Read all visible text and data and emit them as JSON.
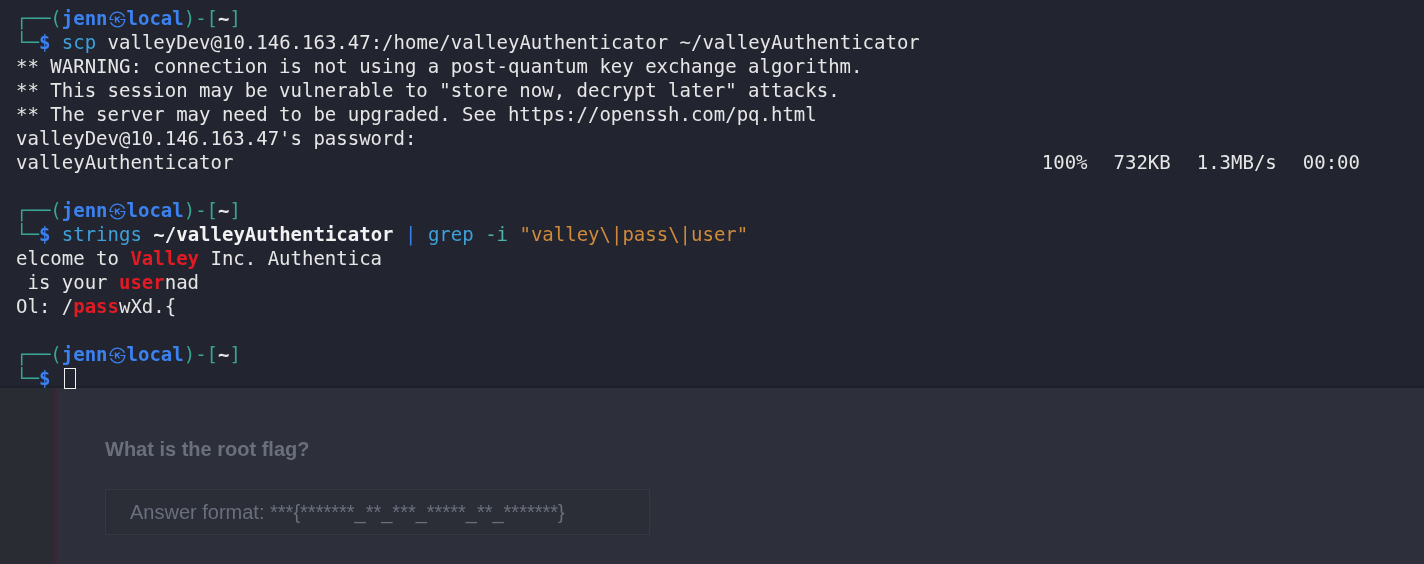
{
  "terminal": {
    "blocks": [
      {
        "kind": "prompt",
        "open": "┌──(",
        "user": "jenn",
        "at": "㉿",
        "host": "local",
        "mid": ")-[",
        "dir": "~",
        "close": "]",
        "corner": "└─",
        "sigil": "$",
        "tokens": [
          {
            "kind": "command",
            "text": "scp"
          },
          {
            "kind": "arg",
            "text": "valleyDev@10.146.163.47:/home/valleyAuthenticator"
          },
          {
            "kind": "arg",
            "text": "~/valleyAuthenticator"
          }
        ]
      },
      {
        "kind": "output",
        "segments": [
          {
            "text": "** WARNING: connection is not using a post-quantum key exchange algorithm.",
            "match": false
          }
        ]
      },
      {
        "kind": "output",
        "segments": [
          {
            "text": "** This session may be vulnerable to \"store now, decrypt later\" attacks.",
            "match": false
          }
        ]
      },
      {
        "kind": "output",
        "segments": [
          {
            "text": "** The server may need to be upgraded. See https://openssh.com/pq.html",
            "match": false
          }
        ]
      },
      {
        "kind": "output",
        "segments": [
          {
            "text": "valleyDev@10.146.163.47's password:",
            "match": false
          }
        ]
      },
      {
        "kind": "progress",
        "file": "valleyAuthenticator",
        "percent": "100%",
        "size": "732KB",
        "rate": "1.3MB/s",
        "eta": "00:00"
      },
      {
        "kind": "blank"
      },
      {
        "kind": "prompt",
        "open": "┌──(",
        "user": "jenn",
        "at": "㉿",
        "host": "local",
        "mid": ")-[",
        "dir": "~",
        "close": "]",
        "corner": "└─",
        "sigil": "$",
        "tokens": [
          {
            "kind": "command",
            "text": "strings"
          },
          {
            "kind": "path",
            "text": "~/valleyAuthenticator"
          },
          {
            "kind": "pipe",
            "text": "|"
          },
          {
            "kind": "command",
            "text": "grep"
          },
          {
            "kind": "option",
            "text": "-i"
          },
          {
            "kind": "string",
            "text": "\"valley\\|pass\\|user\""
          }
        ]
      },
      {
        "kind": "output",
        "segments": [
          {
            "text": "elcome to ",
            "match": false
          },
          {
            "text": "Valley",
            "match": true
          },
          {
            "text": " Inc. Authentica",
            "match": false
          }
        ]
      },
      {
        "kind": "output",
        "segments": [
          {
            "text": " is your ",
            "match": false
          },
          {
            "text": "user",
            "match": true
          },
          {
            "text": "nad",
            "match": false
          }
        ]
      },
      {
        "kind": "output",
        "segments": [
          {
            "text": "Ol: /",
            "match": false
          },
          {
            "text": "pass",
            "match": true
          },
          {
            "text": "wXd.{",
            "match": false
          }
        ]
      },
      {
        "kind": "blank"
      },
      {
        "kind": "prompt",
        "open": "┌──(",
        "user": "jenn",
        "at": "㉿",
        "host": "local",
        "mid": ")-[",
        "dir": "~",
        "close": "]",
        "corner": "└─",
        "sigil": "$",
        "cursor": true
      }
    ]
  },
  "question": {
    "title": "What is the root flag?",
    "answer": {
      "placeholder": "Answer format: ***{*******_**_***_*****_**_*******}"
    }
  }
}
